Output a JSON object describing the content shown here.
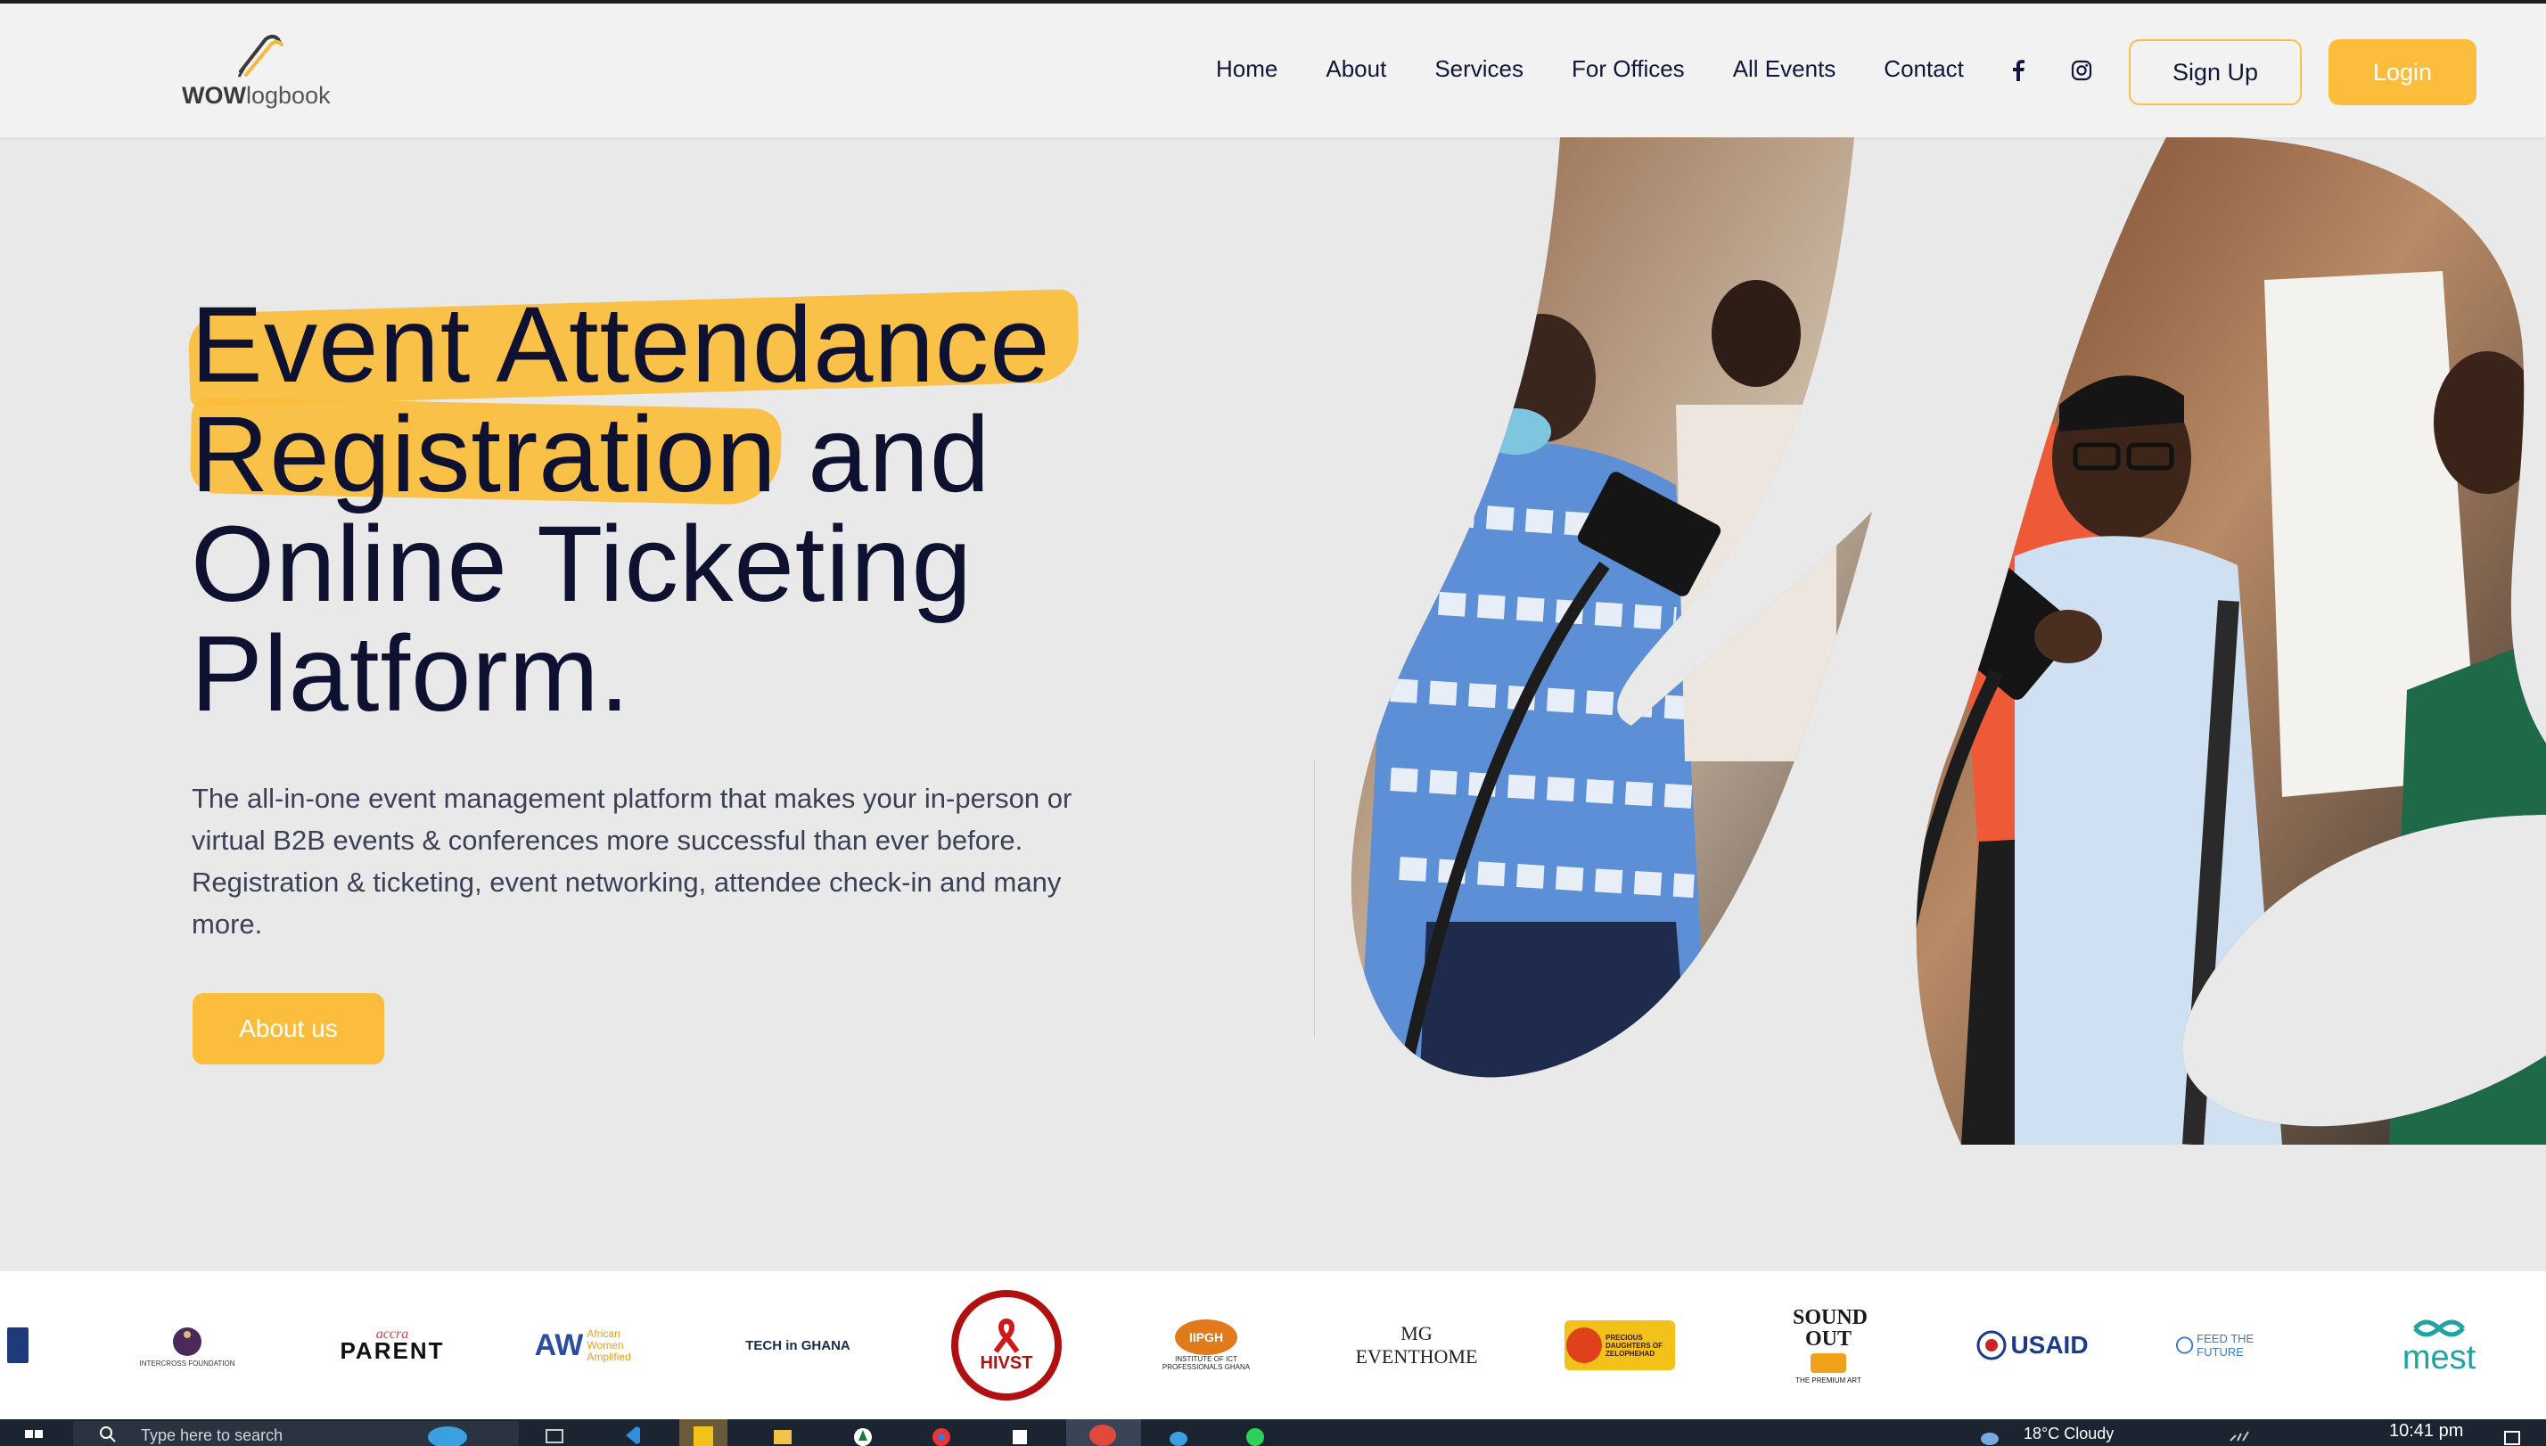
{
  "nav": {
    "logo": {
      "text_bold": "WOW",
      "text_light": "logbook"
    },
    "links": [
      "Home",
      "About",
      "Services",
      "For Offices",
      "All Events",
      "Contact"
    ],
    "social": [
      "facebook-icon",
      "instagram-icon"
    ],
    "signup_label": "Sign Up",
    "login_label": "Login"
  },
  "hero": {
    "headline_lines": [
      "Event Attendance",
      "Registration and",
      "Online Ticketing",
      "Platform."
    ],
    "description": "The all-in-one event management platform that makes your in-person or virtual B2B events & conferences more successful than ever before. Registration & ticketing, event networking, attendee check-in and many more.",
    "button_label": "About us"
  },
  "partners": [
    {
      "name": "INTERCROSS FOUNDATION"
    },
    {
      "name": "PARENT",
      "prefix": "accra"
    },
    {
      "name": "African Women Amplified"
    },
    {
      "name": "TECH in GHANA"
    },
    {
      "name": "HIVST"
    },
    {
      "name": "IIPGH",
      "sub": "INSTITUTE OF ICT PROFESSIONALS GHANA"
    },
    {
      "name": "MG",
      "sub": "EVENTHOME"
    },
    {
      "name": "PRECIOUS DAUGHTERS OF ZELOPHEHAD"
    },
    {
      "name": "SOUND OUT",
      "sub": "THE PREMIUM ART"
    },
    {
      "name": "USAID"
    },
    {
      "name": "FEED THE FUTURE"
    },
    {
      "name": "mest"
    }
  ],
  "taskbar": {
    "search_placeholder": "Type here to search",
    "weather": "18°C  Cloudy",
    "time": "10:41 pm"
  },
  "colors": {
    "accent": "#fbbd3b",
    "text_dark": "#0e1130",
    "bg": "#e9e9e9"
  }
}
